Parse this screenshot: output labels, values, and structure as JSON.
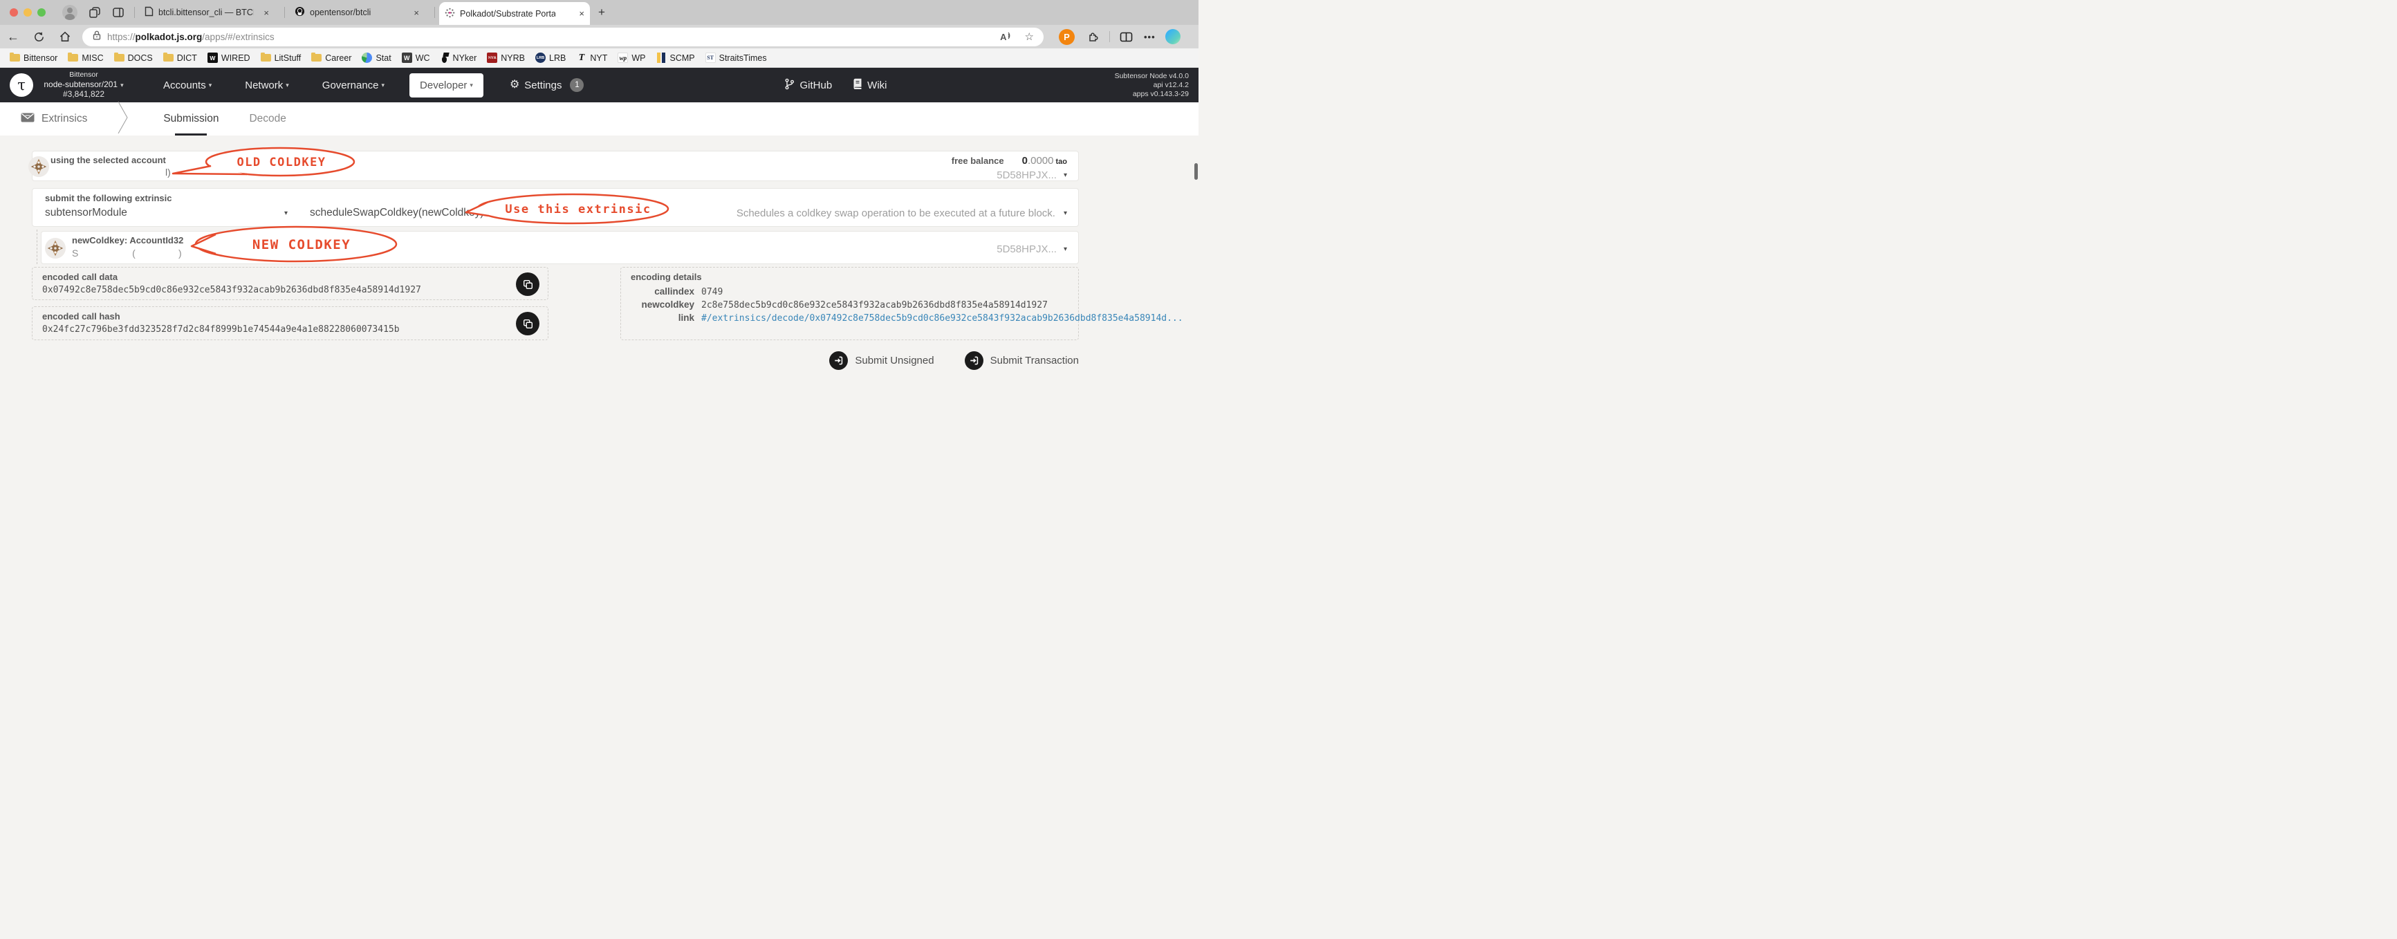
{
  "browser": {
    "tabs": [
      {
        "title": "btcli.bittensor_cli — BTCLI Docs"
      },
      {
        "title": "opentensor/btcli"
      },
      {
        "title": "Polkadot/Substrate Portal"
      }
    ],
    "url": {
      "scheme": "https://",
      "host": "polkadot.js.org",
      "path": "/apps/#/extrinsics"
    },
    "bookmarks": [
      {
        "label": "Bittensor"
      },
      {
        "label": "MISC"
      },
      {
        "label": "DOCS"
      },
      {
        "label": "DICT"
      },
      {
        "label": "WIRED",
        "glyph": "W"
      },
      {
        "label": "LitStuff"
      },
      {
        "label": "Career"
      },
      {
        "label": "Stat"
      },
      {
        "label": "WC",
        "glyph": "W"
      },
      {
        "label": "NYker"
      },
      {
        "label": "NYRB",
        "glyph": "NYR"
      },
      {
        "label": "LRB",
        "glyph": "LRB"
      },
      {
        "label": "NYT",
        "glyph": "T"
      },
      {
        "label": "WP",
        "glyph": "wp"
      },
      {
        "label": "SCMP"
      },
      {
        "label": "StraitsTimes",
        "glyph": "ST"
      }
    ]
  },
  "app_header": {
    "chain": "Bittensor",
    "node": "node-subtensor/201",
    "block": "#3,841,822",
    "nav": [
      {
        "label": "Accounts"
      },
      {
        "label": "Network"
      },
      {
        "label": "Governance"
      },
      {
        "label": "Developer"
      }
    ],
    "settings": {
      "label": "Settings",
      "badge": "1"
    },
    "links": {
      "github": "GitHub",
      "wiki": "Wiki"
    },
    "version": {
      "node": "Subtensor Node v4.0.0",
      "api": "api v12.4.2",
      "apps": "apps v0.143.3-29"
    }
  },
  "page": {
    "section": "Extrinsics",
    "tabs": [
      {
        "label": "Submission"
      },
      {
        "label": "Decode"
      }
    ],
    "account": {
      "label": "using the selected account",
      "name_remnant": "l)",
      "balance_label": "free balance",
      "balance_int": "0",
      "balance_frac": ".0000",
      "balance_unit": "tao",
      "address": "5D58HPJX..."
    },
    "extrinsic": {
      "label": "submit the following extrinsic",
      "module": "subtensorModule",
      "method": "scheduleSwapColdkey(newColdkey)",
      "description": "Schedules a coldkey swap operation to be executed at a future block."
    },
    "param": {
      "label": "newColdkey: AccountId32",
      "name_remnant": "S                    (                )",
      "address": "5D58HPJX..."
    },
    "call_data": {
      "label": "encoded call data",
      "value": "0x07492c8e758dec5b9cd0c86e932ce5843f932acab9b2636dbd8f835e4a58914d1927"
    },
    "call_hash": {
      "label": "encoded call hash",
      "value": "0x24fc27c796be3fdd323528f7d2c84f8999b1e74544a9e4a1e88228060073415b"
    },
    "details": {
      "label": "encoding details",
      "callindex_label": "callindex",
      "callindex": "0749",
      "newcoldkey_label": "newcoldkey",
      "newcoldkey": "2c8e758dec5b9cd0c86e932ce5843f932acab9b2636dbd8f835e4a58914d1927",
      "link_label": "link",
      "link": "#/extrinsics/decode/0x07492c8e758dec5b9cd0c86e932ce5843f932acab9b2636dbd8f835e4a58914d..."
    },
    "actions": {
      "unsigned": "Submit Unsigned",
      "signed": "Submit Transaction"
    },
    "annotations": {
      "old": "OLD COLDKEY",
      "use": "Use this extrinsic",
      "new": "NEW COLDKEY"
    }
  },
  "icons": {
    "caret": "▾",
    "close": "×",
    "plus": "+",
    "back": "←",
    "star": "☆",
    "more": "•••",
    "gear": "⚙"
  }
}
